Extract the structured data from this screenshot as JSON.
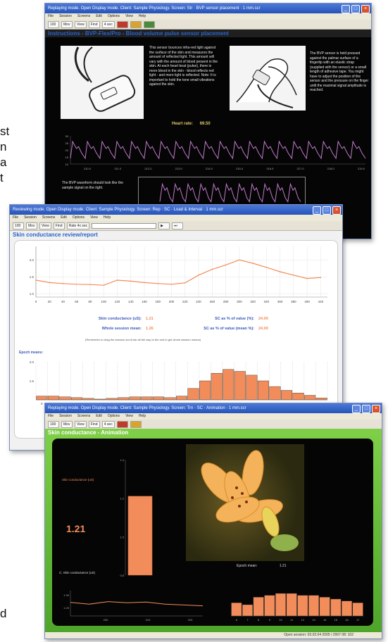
{
  "page_text": {
    "fragment_left_lines": [
      "st",
      "n",
      "a",
      "t"
    ],
    "fragment_bottom": "d"
  },
  "window_bvp": {
    "title": "Replaying mode. Open Display mode. Client: Sample Physiology. Screen: Str · BVP sensor placement · 1 mm.scr",
    "menu": [
      "File",
      "Session",
      "Screens",
      "Edit",
      "Options",
      "View",
      "Help"
    ],
    "toolbar": [
      "100",
      "Mov",
      "View",
      "Find",
      "4 sec"
    ],
    "heading": "Instructions - BVP-Flex/Pro - Blood volume pulse sensor placement",
    "desc_left": "This sensor bounces infra-red light against the surface of the skin and measures the amount of reflected light. This amount will vary with the amount of blood present in the skin. At each heart beat (pulse), there is more blood in the skin - blood reflects red light - and more light is reflected. Note: It is important to hold the tone small vibrations against the skin.",
    "desc_right": "The BVP sensor is held pressed against the palmar surface of a fingertip with an elastic strap (supplied with the sensor) or a small length of adhesive tape. You might have to adjust the position of the sensor and the pressure on the finger until the maximal signal amplitude is reached.",
    "heart_rate_label": "Heart rate:",
    "heart_rate_value": "69.50",
    "sample_note": "The BVP waveform should look like the sample signal on the right.",
    "chart_data": {
      "type": "line",
      "title": "",
      "x_tick_labels": [
        "210.0",
        "211.0",
        "212.0",
        "213.0",
        "214.0",
        "215.0",
        "216.0",
        "217.0",
        "218.0",
        "219.0"
      ],
      "y_tick_labels": [
        "30",
        "25",
        "20",
        "15",
        "10"
      ],
      "beats_visible": 20
    }
  },
  "window_sc": {
    "title": "Reviewing mode. Open Display mode. Client: Sample Physiology. Screen: Rep · SC · Load & Interval · 1 mm.scr",
    "menu": [
      "File",
      "Session",
      "Screens",
      "Edit",
      "Options",
      "View",
      "Help"
    ],
    "toolbar": [
      "100",
      "Mov",
      "View",
      "Find",
      "Rate 4x sec"
    ],
    "heading": "Skin conductance review/report",
    "chart_data": {
      "type": "line",
      "title": "",
      "x": [
        0,
        20,
        40,
        60,
        80,
        100,
        120,
        140,
        160,
        180,
        200,
        220,
        240,
        260,
        280,
        300,
        320,
        340,
        360,
        380,
        400,
        420
      ],
      "values": [
        1.4,
        1.33,
        1.3,
        1.28,
        1.27,
        1.25,
        1.4,
        1.37,
        1.33,
        1.3,
        1.28,
        1.32,
        1.55,
        1.72,
        1.85,
        2.0,
        1.9,
        1.78,
        1.65,
        1.55,
        1.45,
        1.48
      ],
      "x_tick_labels": [
        "0",
        "20",
        "40",
        "60",
        "80",
        "100",
        "120",
        "140",
        "160",
        "180",
        "200",
        "220",
        "240",
        "260",
        "280",
        "300",
        "320",
        "340",
        "360",
        "380",
        "400",
        "420"
      ],
      "y_tick_labels": [
        "2.0",
        "1.5",
        "1.0"
      ],
      "xlim": [
        0,
        430
      ],
      "ylim": [
        0.9,
        2.4
      ]
    },
    "stats": [
      {
        "label": "Skin conductance (uS):",
        "value": "1.21"
      },
      {
        "label": "Whole session mean:",
        "value": "1.26"
      },
      {
        "label": "SC as % of value (%):",
        "value": "24.00"
      },
      {
        "label": "SC as % of value (mean %):",
        "value": "24.00"
      }
    ],
    "note": "(Remember to drag the session scroll bar all the way to the end to get whole session means)",
    "epoch_label": "Epoch means:",
    "epoch_chart": {
      "type": "bar",
      "categories": [
        "0",
        "1",
        "2",
        "3",
        "4",
        "5",
        "6",
        "7",
        "8",
        "9",
        "10",
        "11",
        "12",
        "13",
        "14",
        "15",
        "16",
        "17",
        "18",
        "19",
        "20",
        "21",
        "22",
        "23",
        "24"
      ],
      "values": [
        1.1,
        1.1,
        1.08,
        1.06,
        1.04,
        1.02,
        1.04,
        1.06,
        1.08,
        1.08,
        1.08,
        1.06,
        1.1,
        1.3,
        1.5,
        1.7,
        1.8,
        1.75,
        1.65,
        1.5,
        1.35,
        1.25,
        1.18,
        1.12,
        1.05
      ],
      "y_tick_labels": [
        "2.0",
        "1.5"
      ],
      "ylim": [
        1.0,
        2.0
      ]
    }
  },
  "window_anim": {
    "title": "Replaying mode. Open Display mode. Client: Sample Physiology. Screen: Trn · SC · Animation · 1 mm.scr",
    "menu": [
      "File",
      "Session",
      "Screens",
      "Edit",
      "Options",
      "View",
      "Help"
    ],
    "toolbar": [
      "100",
      "Mov",
      "View",
      "Find",
      "4 sec"
    ],
    "heading": "Skin conductance - Animation",
    "sc_label": "Skin conductance (uS)",
    "sc_value": "1.21",
    "bar_chart": {
      "type": "bar",
      "values": [
        1.21
      ],
      "ylim": [
        0.8,
        1.4
      ],
      "y_tick_labels": [
        "1.4",
        "1.2",
        "1.0",
        "0.8"
      ]
    },
    "line_label": "C: Skin conductance (uS)",
    "line_chart": {
      "type": "line",
      "values": [
        1.23,
        1.22,
        1.235,
        1.228,
        1.232,
        1.22,
        1.215,
        1.21
      ],
      "x_tick_labels": [
        "200",
        "210",
        "220"
      ],
      "y_tick_labels": [
        "1.30",
        "1.20"
      ]
    },
    "epoch_label": "Epoch mean:",
    "epoch_value": "1.21",
    "epoch_chart": {
      "type": "bar",
      "categories": [
        "6",
        "7",
        "8",
        "9",
        "10",
        "11",
        "12",
        "13",
        "14",
        "15",
        "16",
        "17"
      ],
      "values": [
        1.22,
        1.21,
        1.25,
        1.26,
        1.27,
        1.27,
        1.26,
        1.26,
        1.25,
        1.24,
        1.23,
        1.22
      ],
      "ylim": [
        1.15,
        1.3
      ]
    },
    "status": "Open session: 03.02.04 2005 / 2007 08: 102"
  },
  "colors": {
    "accent_blue": "#2b63c9",
    "orange": "#f28c5a",
    "bvp_line": "#c07acb",
    "green_frame": "#6dbd3c"
  }
}
